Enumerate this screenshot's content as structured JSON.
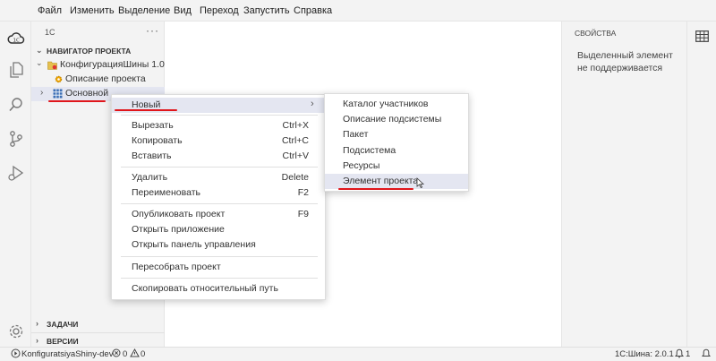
{
  "menubar": {
    "items": [
      "Файл",
      "Изменить",
      "Выделение",
      "Вид",
      "Переход",
      "Запустить",
      "Справка"
    ]
  },
  "activitybar": {
    "icons": [
      "1c-cloud-icon",
      "files-icon",
      "search-icon",
      "source-control-icon",
      "run-debug-icon",
      "settings-gear-icon"
    ]
  },
  "sidebar": {
    "title": "1С",
    "more": "···",
    "navigator_title": "НАВИГАТОР ПРОЕКТА",
    "tree": {
      "config": "КонфигурацияШины 1.0",
      "description": "Описание проекта",
      "main": "Основной"
    },
    "tasks_title": "ЗАДАЧИ",
    "versions_title": "ВЕРСИИ"
  },
  "properties": {
    "title": "СВОЙСТВА",
    "message": "Выделенный элемент не поддерживается"
  },
  "context_menu": {
    "new": "Новый",
    "cut": "Вырезать",
    "cut_key": "Ctrl+X",
    "copy": "Копировать",
    "copy_key": "Ctrl+C",
    "paste": "Вставить",
    "paste_key": "Ctrl+V",
    "delete": "Удалить",
    "delete_key": "Delete",
    "rename": "Переименовать",
    "rename_key": "F2",
    "publish": "Опубликовать проект",
    "publish_key": "F9",
    "open_app": "Открыть приложение",
    "open_panel": "Открыть панель управления",
    "rebuild": "Пересобрать проект",
    "copy_path": "Скопировать относительный путь"
  },
  "submenu": {
    "items": [
      "Каталог участников",
      "Описание подсистемы",
      "Пакет",
      "Подсистема",
      "Ресурсы",
      "Элемент проекта"
    ]
  },
  "statusbar": {
    "project": "KonfiguratsiyaShiny-dev",
    "errors": "0",
    "warnings": "0",
    "version": "1С:Шина: 2.0.1",
    "notifications": "1"
  },
  "colors": {
    "accent_red": "#e0161b",
    "highlight": "#e4e6f1",
    "tree_selected": "#e4e6f1"
  }
}
